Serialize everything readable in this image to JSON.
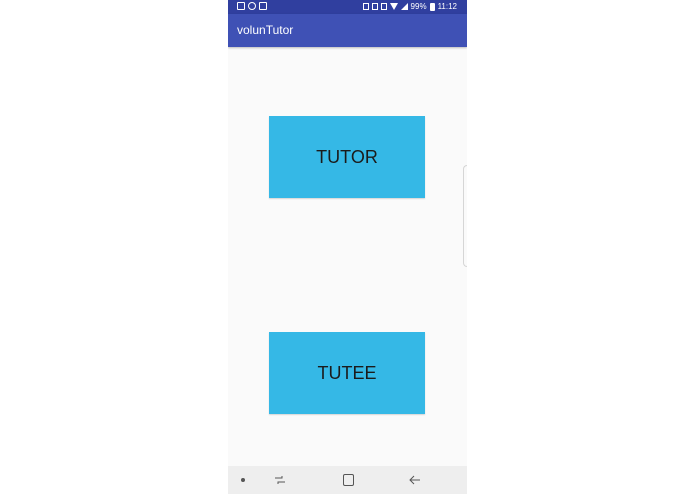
{
  "status_bar": {
    "battery_text": "99%",
    "time": "11:12"
  },
  "app_bar": {
    "title": "volunTutor"
  },
  "main": {
    "tutor_label": "TUTOR",
    "tutee_label": "TUTEE"
  },
  "colors": {
    "status_bar": "#303f9f",
    "app_bar": "#3f51b5",
    "button": "#35b8e6",
    "background": "#fafafa"
  },
  "icons": {
    "status_left": [
      "gallery-icon",
      "messenger-icon",
      "screenshot-icon"
    ],
    "status_right": [
      "alarm-icon",
      "mute-icon",
      "data-saver-icon",
      "wifi-icon",
      "signal-icon",
      "battery-icon"
    ],
    "nav": [
      "menu-dot-icon",
      "recents-icon",
      "home-icon",
      "back-icon"
    ]
  }
}
